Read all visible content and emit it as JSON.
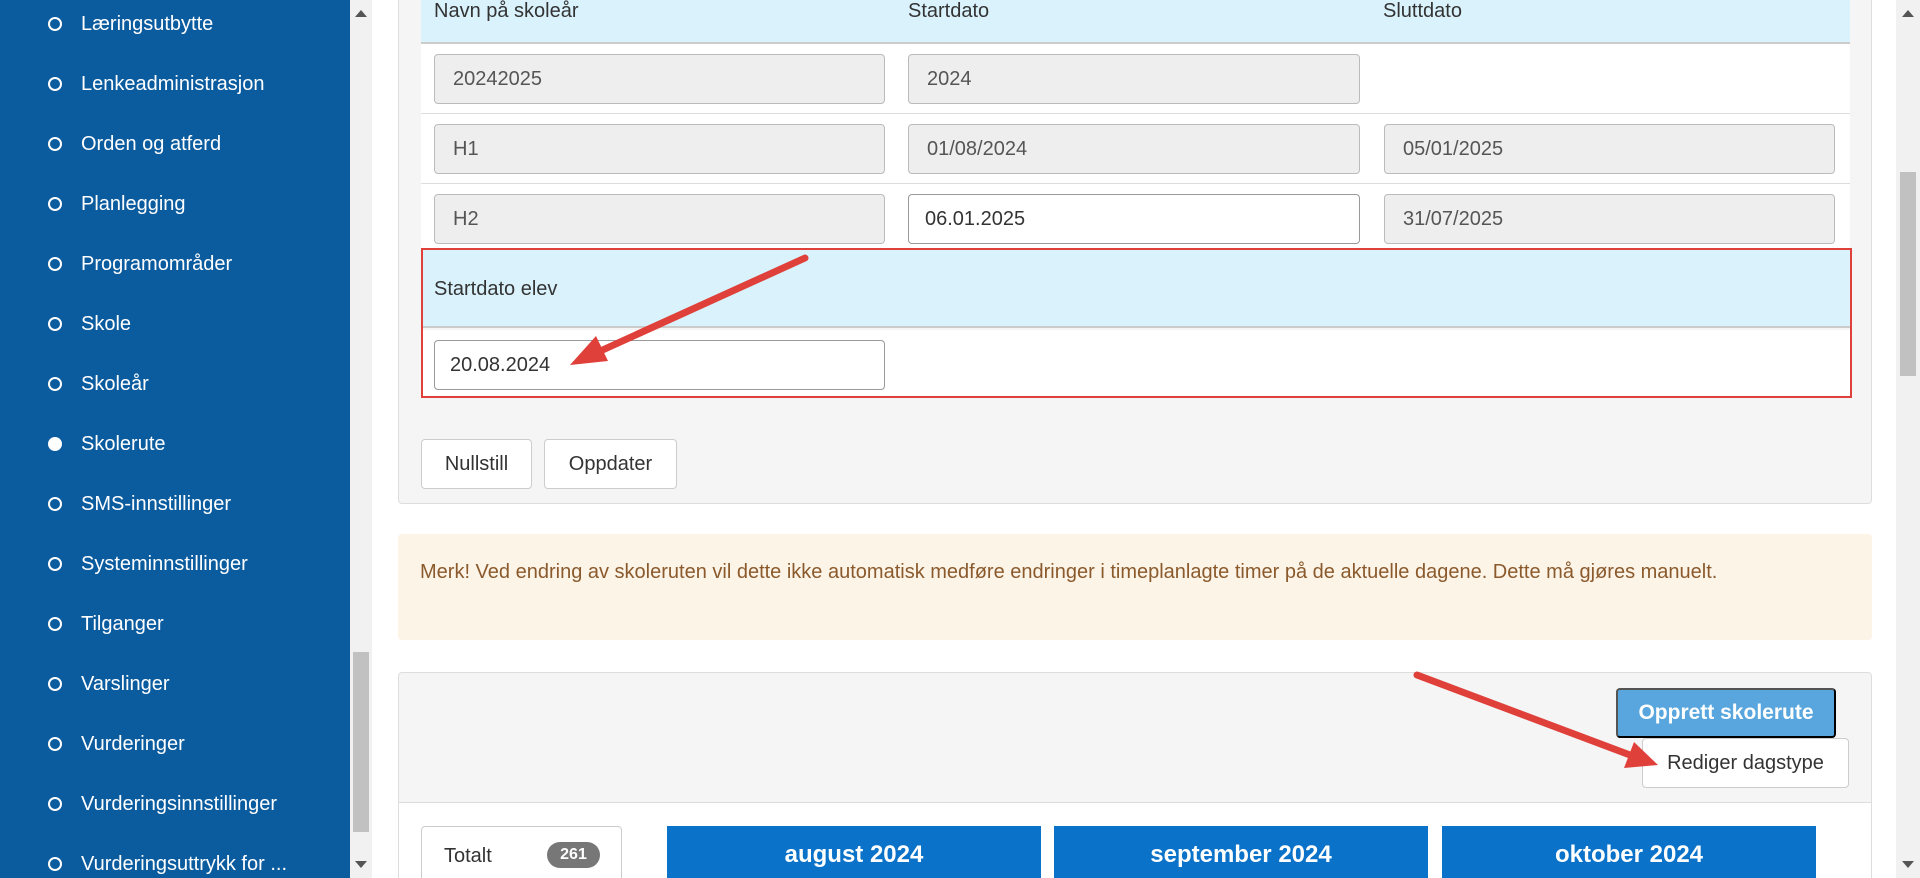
{
  "sidebar": {
    "items": [
      {
        "label": "Læringsutbytte",
        "active": false
      },
      {
        "label": "Lenkeadministrasjon",
        "active": false
      },
      {
        "label": "Orden og atferd",
        "active": false
      },
      {
        "label": "Planlegging",
        "active": false
      },
      {
        "label": "Programområder",
        "active": false
      },
      {
        "label": "Skole",
        "active": false
      },
      {
        "label": "Skoleår",
        "active": false
      },
      {
        "label": "Skolerute",
        "active": true
      },
      {
        "label": "SMS-innstillinger",
        "active": false
      },
      {
        "label": "Systeminnstillinger",
        "active": false
      },
      {
        "label": "Tilganger",
        "active": false
      },
      {
        "label": "Varslinger",
        "active": false
      },
      {
        "label": "Vurderinger",
        "active": false
      },
      {
        "label": "Vurderingsinnstillinger",
        "active": false
      },
      {
        "label": "Vurderingsuttrykk for ...",
        "active": false
      }
    ]
  },
  "table": {
    "headers": [
      "Navn på skoleår",
      "Startdato",
      "Sluttdato"
    ],
    "rows": [
      {
        "name": "20242025",
        "start": "2024",
        "end": ""
      },
      {
        "name": "H1",
        "start": "01/08/2024",
        "end": "05/01/2025"
      },
      {
        "name": "H2",
        "start": "06.01.2025",
        "end": "31/07/2025"
      }
    ]
  },
  "student_start": {
    "label": "Startdato elev",
    "value": "20.08.2024"
  },
  "buttons": {
    "reset": "Nullstill",
    "update": "Oppdater",
    "create": "Opprett skolerute",
    "edit_daytype": "Rediger dagstype"
  },
  "warning": "Merk! Ved endring av skoleruten vil dette ikke automatisk medføre endringer i timeplanlagte timer på de aktuelle dagene. Dette må gjøres manuelt.",
  "summary": {
    "total_label": "Totalt",
    "total_count": "261"
  },
  "months": [
    "august 2024",
    "september 2024",
    "oktober 2024"
  ],
  "colors": {
    "sidebar": "#0b5b9f",
    "header_row": "#d9f2fc",
    "highlight": "#e0403a",
    "primary_button": "#58a6dd",
    "month_header": "#0a72c9",
    "warning_bg": "#fdf4e8"
  }
}
